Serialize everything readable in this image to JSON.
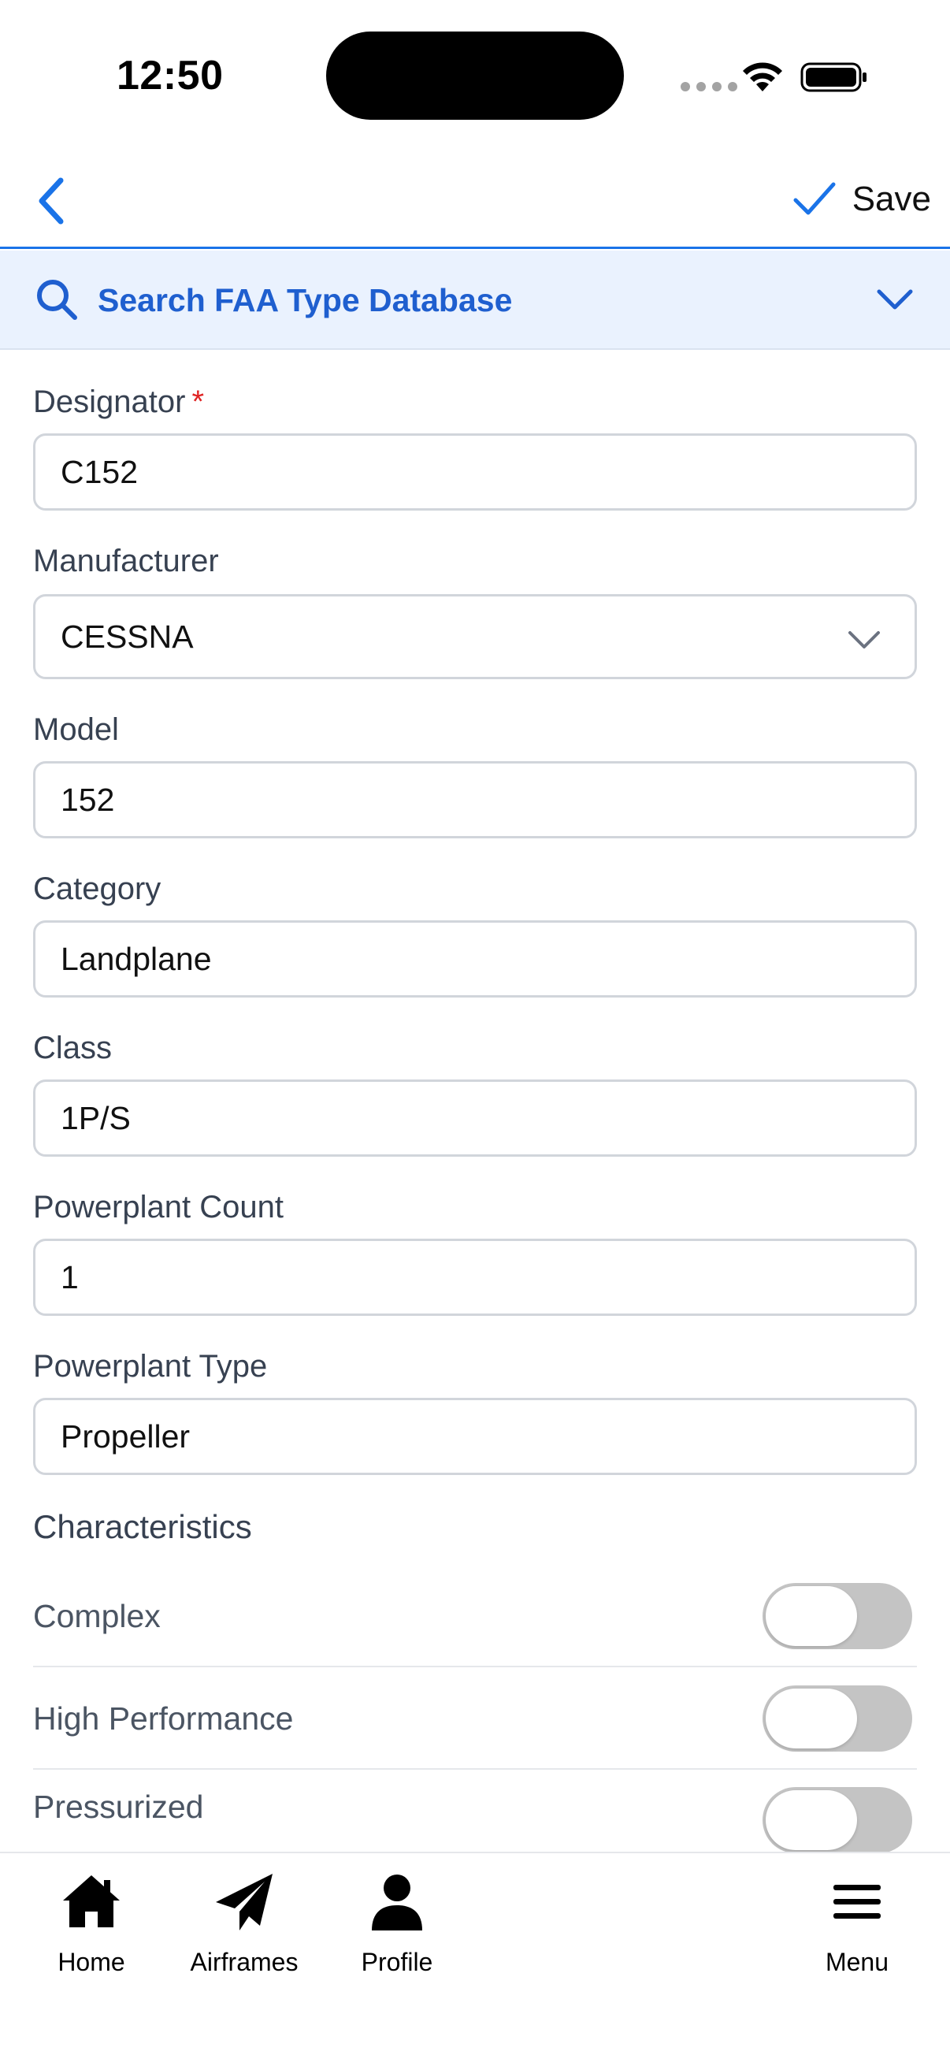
{
  "status_bar": {
    "time": "12:50"
  },
  "header": {
    "back_icon": "chevron-left-icon",
    "save_label": "Save",
    "accent_color": "#1a73e8"
  },
  "search": {
    "label": "Search FAA Type Database",
    "icon": "search-icon",
    "expanded": false
  },
  "form": {
    "designator": {
      "label": "Designator",
      "required_mark": "*",
      "value": "C152"
    },
    "manufacturer": {
      "label": "Manufacturer",
      "value": "CESSNA"
    },
    "model": {
      "label": "Model",
      "value": "152"
    },
    "category": {
      "label": "Category",
      "value": "Landplane"
    },
    "class": {
      "label": "Class",
      "value": "1P/S"
    },
    "powerplant_count": {
      "label": "Powerplant Count",
      "value": "1"
    },
    "powerplant_type": {
      "label": "Powerplant Type",
      "value": "Propeller"
    }
  },
  "characteristics": {
    "title": "Characteristics",
    "items": [
      {
        "label": "Complex",
        "on": false
      },
      {
        "label": "High Performance",
        "on": false
      },
      {
        "label": "Pressurized",
        "on": false
      }
    ]
  },
  "tab_bar": {
    "tabs": [
      {
        "label": "Home",
        "icon": "home-icon"
      },
      {
        "label": "Airframes",
        "icon": "paper-plane-icon"
      },
      {
        "label": "Profile",
        "icon": "person-icon"
      },
      {
        "label": "Menu",
        "icon": "hamburger-menu-icon"
      }
    ]
  }
}
